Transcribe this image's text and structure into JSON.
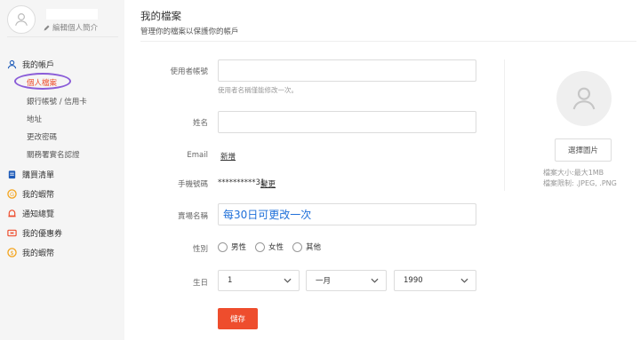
{
  "sidebar": {
    "edit_profile": "編輯個人簡介",
    "account_menu": {
      "title": "我的帳戶",
      "items": [
        "個人檔案",
        "銀行帳號 / 信用卡",
        "地址",
        "更改密碼",
        "關務署實名認證"
      ]
    },
    "menu": [
      "購買清單",
      "我的蝦幣",
      "通知總覽",
      "我的優惠券",
      "我的蝦幣"
    ],
    "icons": [
      "user-icon",
      "clipboard-icon",
      "coin-icon",
      "bell-icon",
      "ticket-icon",
      "dollar-coin-icon"
    ]
  },
  "header": {
    "title": "我的檔案",
    "subtitle": "管理你的檔案以保護你的帳戶"
  },
  "form": {
    "username_label": "使用者帳號",
    "username_value": "",
    "username_hint": "使用者名稱僅能修改一次。",
    "name_label": "姓名",
    "name_value": "",
    "email_label": "Email",
    "email_link": "新增",
    "phone_label": "手機號碼",
    "phone_value": "**********31",
    "phone_link": "變更",
    "store_label": "賣場名稱",
    "store_value": "每30日可更改一次",
    "gender_label": "性別",
    "gender_options": [
      "男性",
      "女性",
      "其他"
    ],
    "birthday_label": "生日",
    "birthday_day": "1",
    "birthday_month": "一月",
    "birthday_year": "1990",
    "save_label": "儲存"
  },
  "avatar_panel": {
    "choose_label": "選擇圖片",
    "size_info": "檔案大小:最大1MB",
    "format_info": "檔案限制: .JPEG, .PNG"
  },
  "colors": {
    "accent": "#ee4d2d",
    "link": "#0055aa",
    "highlight_circle": "#8a5cd8",
    "store_text": "#1e6fd9"
  }
}
